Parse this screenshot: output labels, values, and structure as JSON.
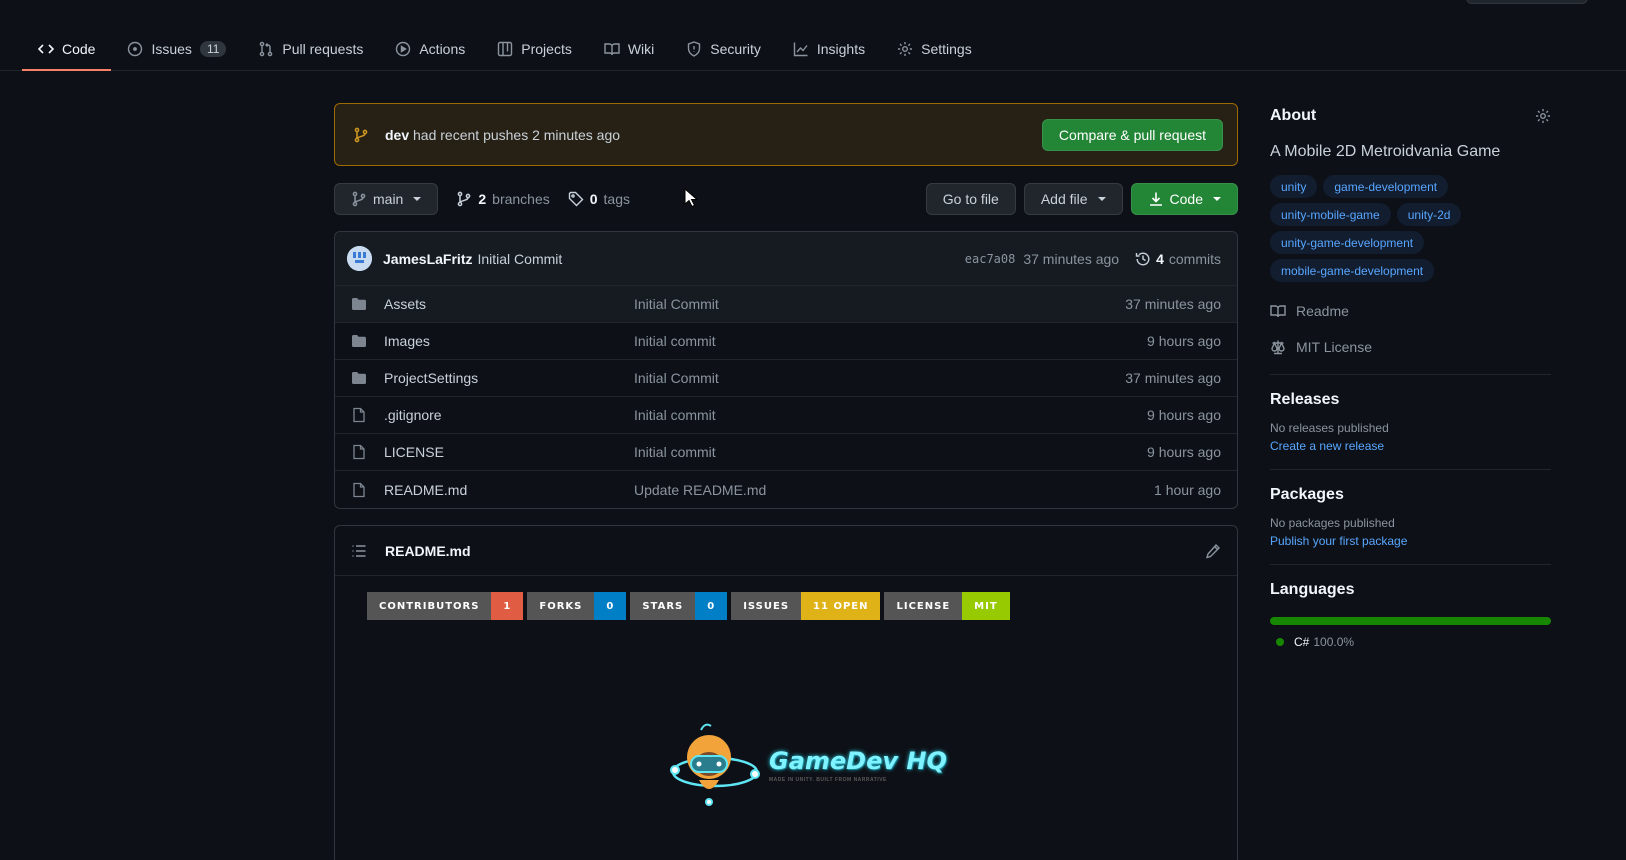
{
  "repo_nav": {
    "tabs": [
      {
        "label": "Code",
        "icon": "code-icon"
      },
      {
        "label": "Issues",
        "icon": "issue-icon",
        "count": "11"
      },
      {
        "label": "Pull requests",
        "icon": "pull-request-icon"
      },
      {
        "label": "Actions",
        "icon": "play-icon"
      },
      {
        "label": "Projects",
        "icon": "table-icon"
      },
      {
        "label": "Wiki",
        "icon": "book-icon"
      },
      {
        "label": "Security",
        "icon": "shield-icon"
      },
      {
        "label": "Insights",
        "icon": "graph-icon"
      },
      {
        "label": "Settings",
        "icon": "gear-icon"
      }
    ]
  },
  "push_banner": {
    "branch": "dev",
    "message": "had recent pushes 2 minutes ago",
    "button": "Compare & pull request"
  },
  "file_nav": {
    "branch": "main",
    "branches_count": "2",
    "branches_label": "branches",
    "tags_count": "0",
    "tags_label": "tags",
    "go_to_file": "Go to file",
    "add_file": "Add file",
    "code": "Code"
  },
  "latest_commit": {
    "author": "JamesLaFritz",
    "message": "Initial Commit",
    "sha": "eac7a08",
    "time": "37 minutes ago",
    "commits_count": "4",
    "commits_label": "commits"
  },
  "files": [
    {
      "type": "dir",
      "name": "Assets",
      "message": "Initial Commit",
      "age": "37 minutes ago"
    },
    {
      "type": "dir",
      "name": "Images",
      "message": "Initial commit",
      "age": "9 hours ago"
    },
    {
      "type": "dir",
      "name": "ProjectSettings",
      "message": "Initial Commit",
      "age": "37 minutes ago"
    },
    {
      "type": "file",
      "name": ".gitignore",
      "message": "Initial commit",
      "age": "9 hours ago"
    },
    {
      "type": "file",
      "name": "LICENSE",
      "message": "Initial commit",
      "age": "9 hours ago"
    },
    {
      "type": "file",
      "name": "README.md",
      "message": "Update README.md",
      "age": "1 hour ago"
    }
  ],
  "readme": {
    "title": "README.md",
    "badges": [
      {
        "key": "CONTRIBUTORS",
        "value": "1",
        "color": "#e05d44"
      },
      {
        "key": "FORKS",
        "value": "0",
        "color": "#007ec6"
      },
      {
        "key": "STARS",
        "value": "0",
        "color": "#007ec6"
      },
      {
        "key": "ISSUES",
        "value": "11 OPEN",
        "color": "#dfb317"
      },
      {
        "key": "LICENSE",
        "value": "MIT",
        "color": "#97ca00"
      }
    ],
    "logo": {
      "name": "GameDev HQ",
      "tagline": "MADE IN UNITY. BUILT FROM NARRATIVE"
    }
  },
  "about": {
    "title": "About",
    "description": "A Mobile 2D Metroidvania Game",
    "topics": [
      "unity",
      "game-development",
      "unity-mobile-game",
      "unity-2d",
      "unity-game-development",
      "mobile-game-development"
    ],
    "readme_label": "Readme",
    "license_label": "MIT License"
  },
  "releases": {
    "title": "Releases",
    "empty": "No releases published",
    "link": "Create a new release"
  },
  "packages": {
    "title": "Packages",
    "empty": "No packages published",
    "link": "Publish your first package"
  },
  "languages": {
    "title": "Languages",
    "items": [
      {
        "name": "C#",
        "percent": "100.0%",
        "color": "#178600"
      }
    ]
  }
}
